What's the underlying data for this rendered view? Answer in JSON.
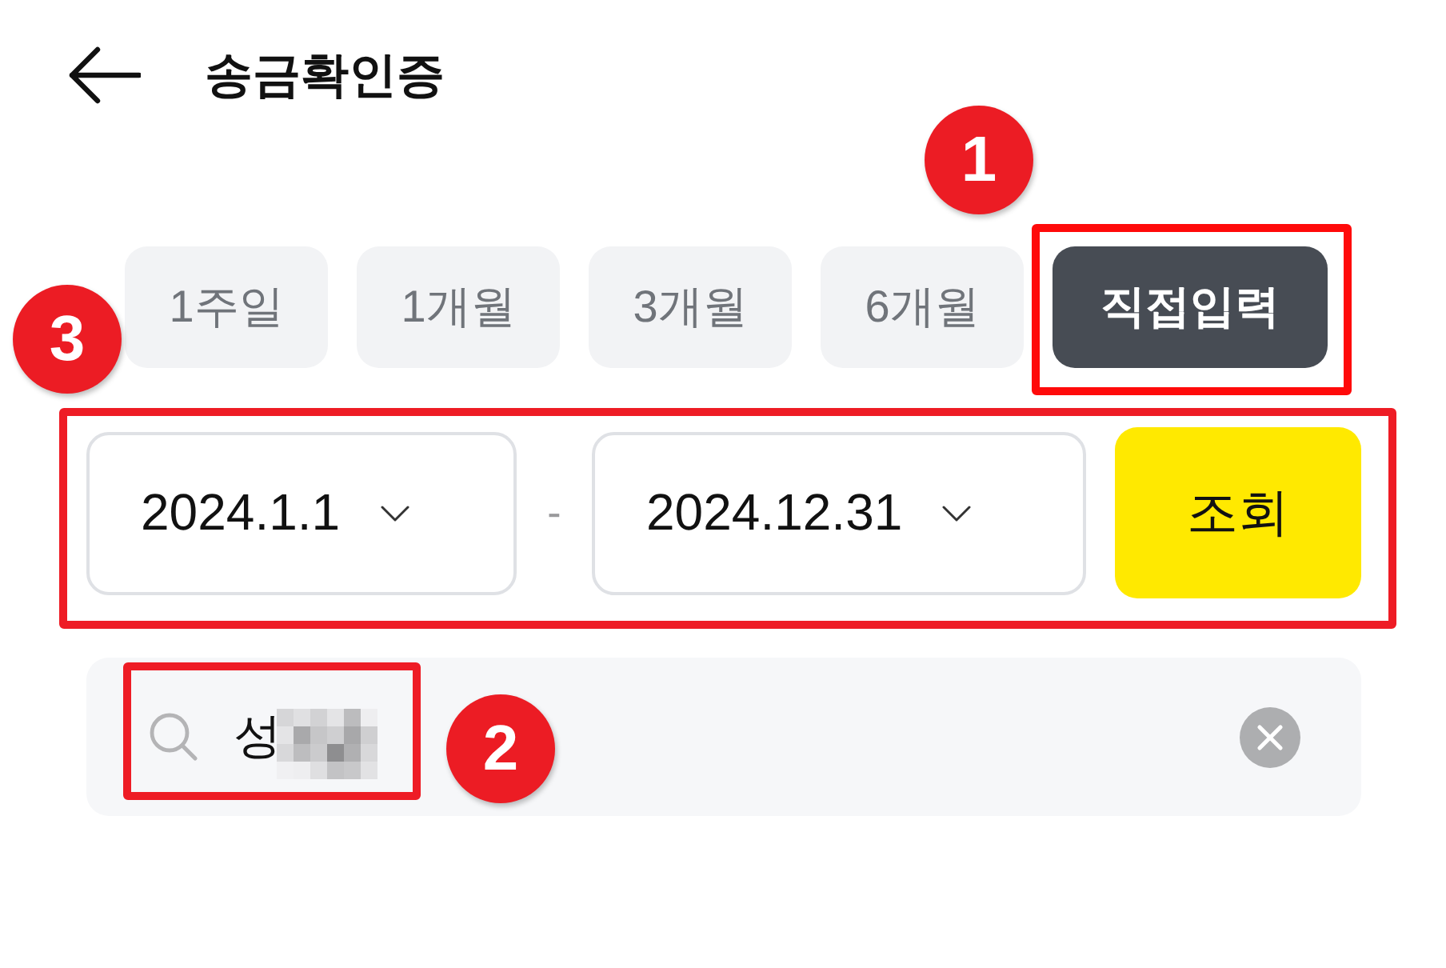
{
  "header": {
    "title": "송금확인증"
  },
  "period_tabs": [
    {
      "label": "1주일",
      "selected": false
    },
    {
      "label": "1개월",
      "selected": false
    },
    {
      "label": "3개월",
      "selected": false
    },
    {
      "label": "6개월",
      "selected": false
    },
    {
      "label": "직접입력",
      "selected": true
    }
  ],
  "date_range": {
    "start": "2024.1.1",
    "separator": "-",
    "end": "2024.12.31",
    "search_button": "조회"
  },
  "search": {
    "value": "성"
  },
  "annotations": [
    {
      "number": "1"
    },
    {
      "number": "2"
    },
    {
      "number": "3"
    }
  ]
}
